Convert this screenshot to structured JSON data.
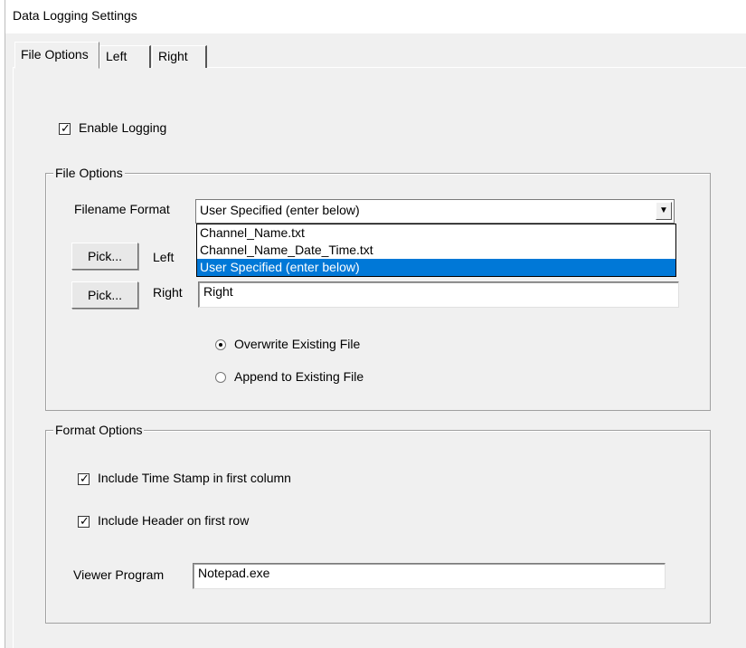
{
  "window": {
    "title": "Data Logging Settings"
  },
  "tabs": [
    {
      "label": "File Options",
      "active": true
    },
    {
      "label": "Left",
      "active": false
    },
    {
      "label": "Right",
      "active": false
    }
  ],
  "enable_logging": {
    "label": "Enable Logging",
    "checked": true
  },
  "file_options": {
    "group_label": "File Options",
    "filename_format_label": "Filename Format",
    "filename_format_value": "User Specified (enter below)",
    "filename_format_options": [
      "Channel_Name.txt",
      "Channel_Name_Date_Time.txt",
      "User Specified (enter below)"
    ],
    "selected_option_index": 2,
    "pick_label": "Pick...",
    "left_label": "Left",
    "right_label": "Right",
    "right_value": "Right",
    "overwrite_label": "Overwrite Existing File",
    "append_label": "Append to Existing File",
    "overwrite_selected": true
  },
  "format_options": {
    "group_label": "Format Options",
    "timestamp_label": "Include Time Stamp in first column",
    "timestamp_checked": true,
    "header_label": "Include Header on first row",
    "header_checked": true,
    "viewer_label": "Viewer Program",
    "viewer_value": "Notepad.exe"
  },
  "colors": {
    "selection": "#0078d7",
    "background": "#f0f0f0"
  }
}
